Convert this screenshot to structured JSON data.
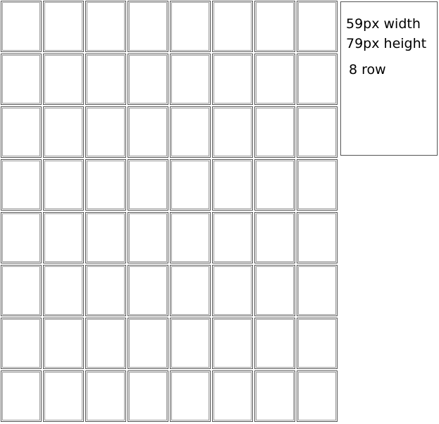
{
  "grid": {
    "rows": 8,
    "columns": 8
  },
  "note": {
    "lines": [
      "59px width",
      "79px height",
      "8 row"
    ]
  },
  "colors": {
    "border": "#555555",
    "inner_border": "#9a9a9a",
    "background": "#ffffff",
    "text": "#000000"
  }
}
